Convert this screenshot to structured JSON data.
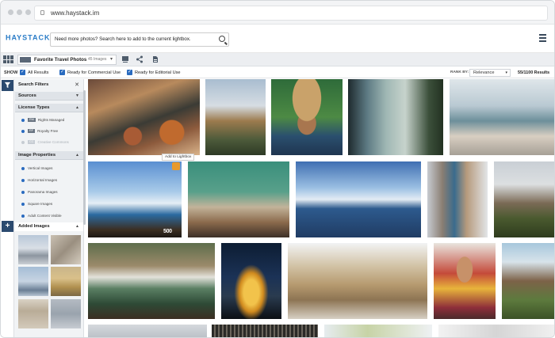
{
  "browser": {
    "url": "www.haystack.im"
  },
  "header": {
    "logo_text": "HAYSTACK",
    "search_placeholder": "Need more photos? Search here to add to the current lightbox."
  },
  "toolbar": {
    "lightbox_name": "Favorite Travel Photos",
    "lightbox_count": "45 Images"
  },
  "filters_bar": {
    "show_label": "SHOW",
    "options": [
      "All Results",
      "Ready for Commercial Use",
      "Ready for Editorial Use"
    ],
    "rank_label": "RANK BY:",
    "rank_value": "Relevance",
    "results": "55/1100 Results"
  },
  "sidebar": {
    "title": "Search Filters",
    "sources_label": "Sources",
    "license_label": "License Types",
    "license_items": [
      {
        "tag": "RM",
        "label": "Rights Managed"
      },
      {
        "tag": "RF",
        "label": "Royalty Free"
      },
      {
        "tag": "CC",
        "label": "Creative Commons"
      }
    ],
    "props_label": "Image Properties",
    "props_items": [
      "Vertical Images",
      "Horizontal Images",
      "Panorama Images",
      "Square Images",
      "Adult Content Visible"
    ],
    "added_label": "Added Images"
  },
  "grid": {
    "tooltip": "Add to Lightbox",
    "badge": "500"
  },
  "colors": {
    "accent": "#2a6bbf",
    "nav": "#2b4a6f",
    "brand_orange": "#e87b2e"
  }
}
